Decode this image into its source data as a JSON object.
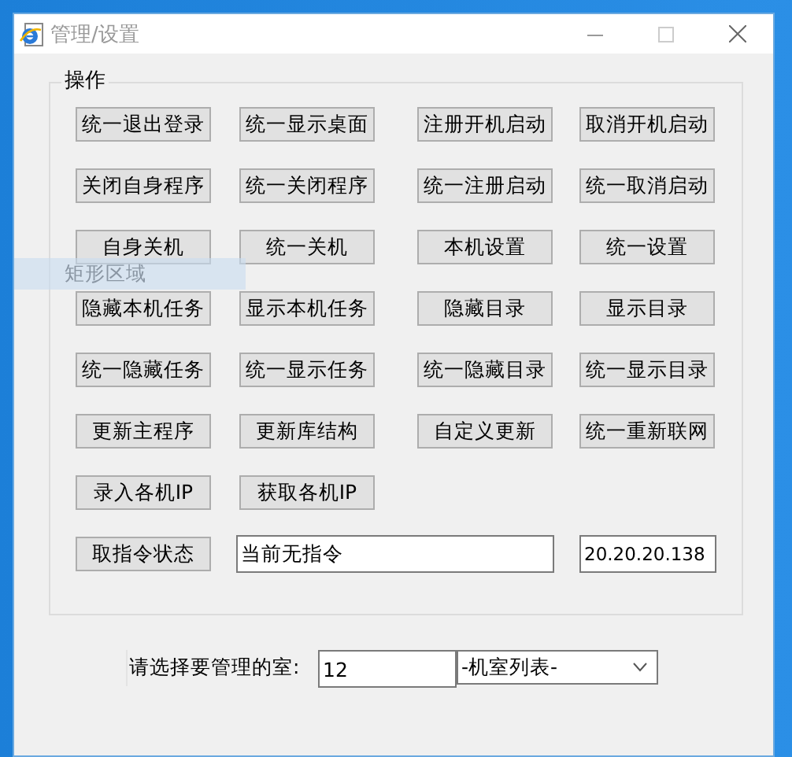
{
  "window": {
    "title": "管理/设置"
  },
  "group": {
    "title": "操作",
    "button_rows": [
      [
        "统一退出登录",
        "统一显示桌面",
        "注册开机启动",
        "取消开机启动"
      ],
      [
        "关闭自身程序",
        "统一关闭程序",
        "统一注册启动",
        "统一取消启动"
      ],
      [
        "自身关机",
        "统一关机",
        "本机设置",
        "统一设置"
      ],
      [
        "隐藏本机任务",
        "显示本机任务",
        "隐藏目录",
        "显示目录"
      ],
      [
        "统一隐藏任务",
        "统一显示任务",
        "统一隐藏目录",
        "统一显示目录"
      ],
      [
        "更新主程序",
        "更新库结构",
        "自定义更新",
        "统一重新联网"
      ],
      [
        "录入各机IP",
        "获取各机IP"
      ]
    ],
    "status_button": "取指令状态",
    "status_field": "当前无指令",
    "ip_field": "20.20.20.138"
  },
  "overlay": {
    "label": "矩形区域"
  },
  "room": {
    "label": "请选择要管理的室:",
    "value": "12",
    "dropdown": "-机室列表-"
  }
}
